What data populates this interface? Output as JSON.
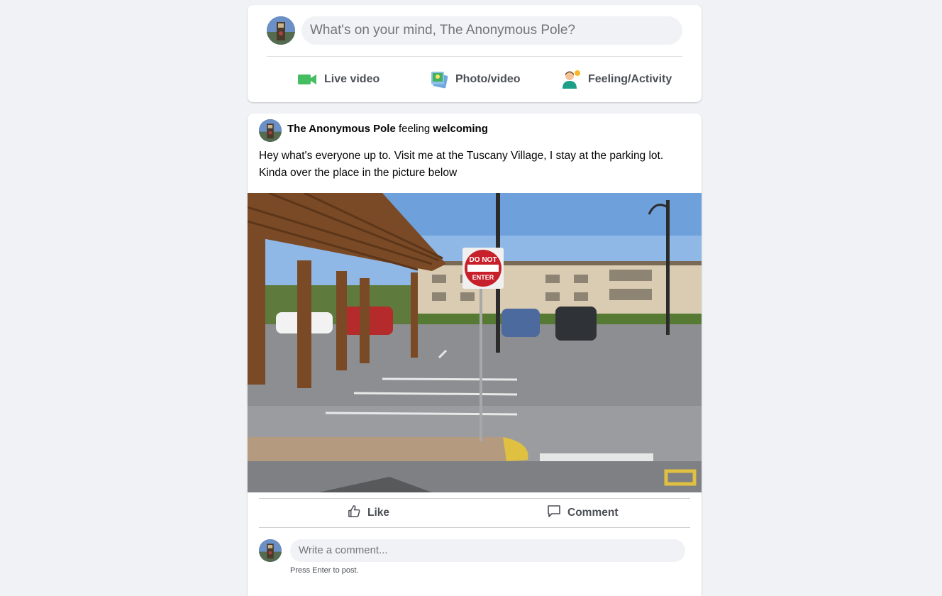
{
  "composer": {
    "placeholder": "What's on your mind, The Anonymous Pole?",
    "actions": [
      {
        "label": "Live video",
        "icon": "video-camera-icon",
        "color": "#45bd62"
      },
      {
        "label": "Photo/video",
        "icon": "photo-icon",
        "color": "#41b35d"
      },
      {
        "label": "Feeling/Activity",
        "icon": "feeling-person-icon",
        "color": "#f7b928"
      }
    ]
  },
  "post": {
    "author": "The Anonymous Pole",
    "feeling_prefix": "feeling",
    "feeling": "welcoming",
    "text": "Hey what's everyone up to. Visit me at the Tuscany Village, I stay at the parking lot. Kinda over the place in the picture below",
    "image": {
      "sign_line1": "DO NOT",
      "sign_line2": "ENTER"
    },
    "actions": {
      "like": "Like",
      "comment": "Comment"
    },
    "comment_box": {
      "placeholder": "Write a comment...",
      "hint": "Press Enter to post."
    }
  },
  "colors": {
    "page_bg": "#f0f2f5",
    "card_bg": "#ffffff",
    "muted_text": "#65676b",
    "action_text": "#4b4f56"
  }
}
